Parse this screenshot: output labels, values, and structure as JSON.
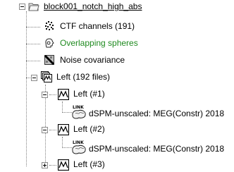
{
  "tree": {
    "root": {
      "label": "block001_notch_high_abs"
    },
    "items": [
      {
        "label": "CTF channels (191)",
        "icon": "channels-icon"
      },
      {
        "label": "Overlapping spheres",
        "icon": "head-model-icon",
        "color": "#1f8a1f"
      },
      {
        "label": "Noise covariance",
        "icon": "noise-covariance-icon"
      },
      {
        "label": "Left (192 files)",
        "icon": "data-list-icon",
        "expanded": true
      },
      {
        "label": "Left (#1)",
        "icon": "recording-icon",
        "expanded": true
      },
      {
        "label": "dSPM-unscaled: MEG(Constr) 2018",
        "icon": "brain-link-icon",
        "link_text": "LINK"
      },
      {
        "label": "Left (#2)",
        "icon": "recording-icon",
        "expanded": true
      },
      {
        "label": "dSPM-unscaled: MEG(Constr) 2018",
        "icon": "brain-link-icon",
        "link_text": "LINK"
      },
      {
        "label": "Left (#3)",
        "icon": "recording-icon",
        "expanded": false
      }
    ]
  }
}
